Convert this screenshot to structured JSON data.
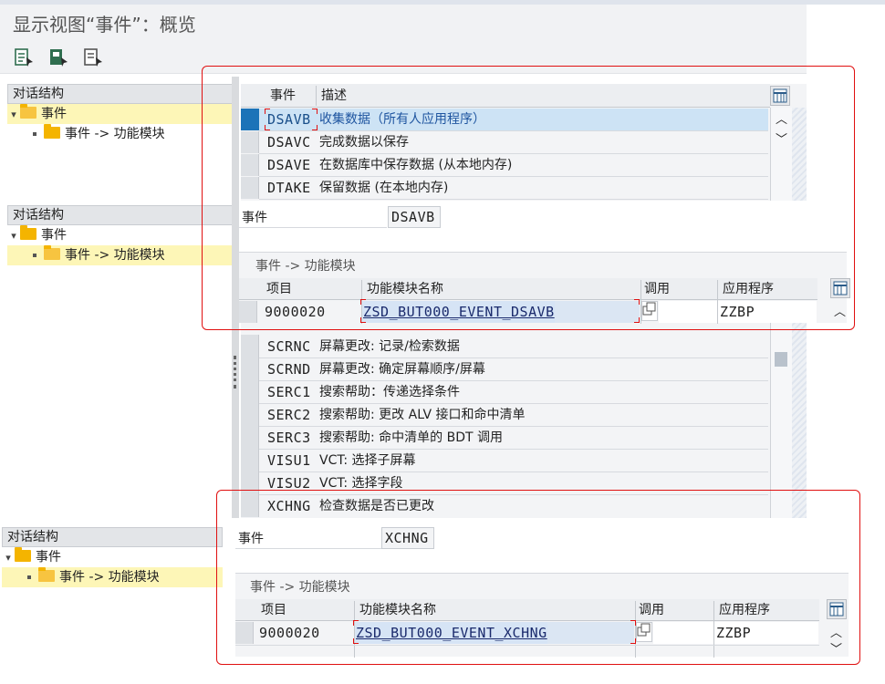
{
  "window": {
    "title": "显示视图“事件”：概览"
  },
  "toolbar": {
    "buttons": [
      {
        "icon": "display-icon"
      },
      {
        "icon": "save-icon"
      },
      {
        "icon": "print-icon"
      }
    ]
  },
  "tree": {
    "header": "对话结构",
    "node_event": "事件",
    "node_fm": "事件 -> 功能模块"
  },
  "events_table": {
    "col_event": "事件",
    "col_desc": "描述",
    "rows": [
      {
        "event": "DSAVB",
        "desc": "收集数据（所有人应用程序）"
      },
      {
        "event": "DSAVC",
        "desc": "完成数据以保存"
      },
      {
        "event": "DSAVE",
        "desc": "在数据库中保存数据 (从本地内存)"
      },
      {
        "event": "DTAKE",
        "desc": "保留数据 (在本地内存)"
      }
    ],
    "rows_lower": [
      {
        "event": "SCRNC",
        "desc": "屏幕更改: 记录/检索数据"
      },
      {
        "event": "SCRND",
        "desc": "屏幕更改: 确定屏幕顺序/屏幕"
      },
      {
        "event": "SERC1",
        "desc": "搜索帮助：传递选择条件"
      },
      {
        "event": "SERC2",
        "desc": "搜索帮助: 更改 ALV 接口和命中清单"
      },
      {
        "event": "SERC3",
        "desc": "搜索帮助: 命中清单的 BDT 调用"
      },
      {
        "event": "VISU1",
        "desc": "VCT: 选择子屏幕"
      },
      {
        "event": "VISU2",
        "desc": "VCT: 选择字段"
      },
      {
        "event": "XCHNG",
        "desc": "检查数据是否已更改"
      }
    ]
  },
  "detail1": {
    "event_label": "事件",
    "event_value": "DSAVB",
    "section_title": "事件 -> 功能模块",
    "col_item": "项目",
    "col_fm": "功能模块名称",
    "col_call": "调用",
    "col_app": "应用程序",
    "row": {
      "item": "9000020",
      "fm": "ZSD_BUT000_EVENT_DSAVB",
      "app": "ZZBP"
    }
  },
  "detail2": {
    "event_label": "事件",
    "event_value": "XCHNG",
    "section_title": "事件 -> 功能模块",
    "col_item": "项目",
    "col_fm": "功能模块名称",
    "col_call": "调用",
    "col_app": "应用程序",
    "row": {
      "item": "9000020",
      "fm": "ZSD_BUT000_EVENT_XCHNG",
      "app": "ZZBP"
    }
  },
  "colors": {
    "highlight_row": "#cde3f5",
    "tree_highlight": "#fdf6b7",
    "annotation": "#e01010"
  }
}
